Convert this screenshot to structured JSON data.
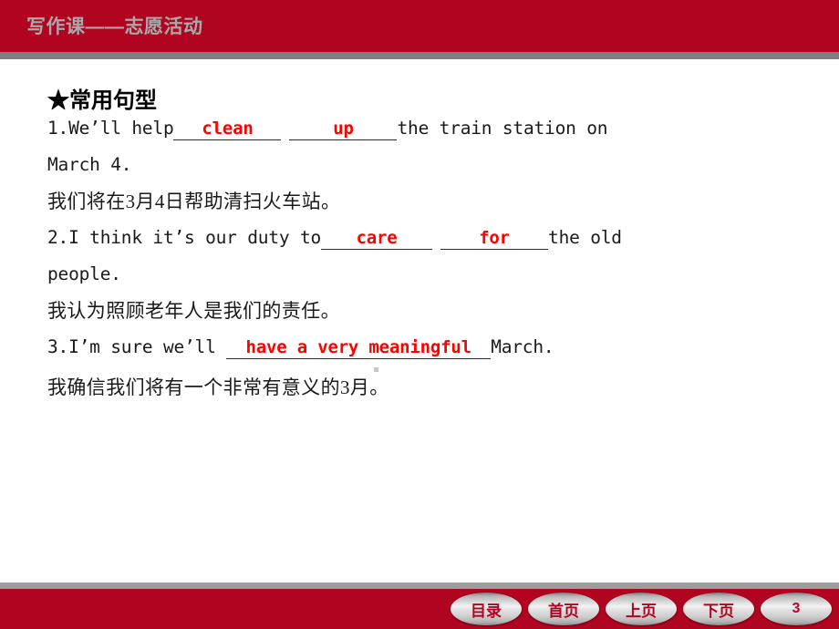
{
  "header": {
    "title": "写作课——志愿活动",
    "bar_color": "#b00420",
    "title_color": "#a8a8a8",
    "rule_color": "#7f7f7f"
  },
  "content": {
    "section_heading": "★常用句型",
    "sentences": [
      {
        "index": "1.",
        "en_pre": "1.We’ll help",
        "blank1": "clean",
        "blank2": "up",
        "en_mid": "",
        "en_post": "the train station on",
        "en_wrap": "March 4.",
        "zh": "我们将在3月4日帮助清扫火车站。"
      },
      {
        "index": "2.",
        "en_pre": "2.I think it’s our duty to",
        "blank1": "care",
        "blank2": "for",
        "en_post": "the old",
        "en_wrap": "people.",
        "zh": "我认为照顾老年人是我们的责任。"
      },
      {
        "index": "3.",
        "en_pre": "3.I’m sure we’ll ",
        "blank1": "have a very meaningful",
        "en_post": "March.",
        "zh": "我确信我们将有一个非常有意义的3月。"
      }
    ],
    "answer_color": "#ff0000"
  },
  "footer": {
    "bar_color": "#b00420",
    "rule_color": "#9e9e9e",
    "buttons": [
      {
        "label": "目录",
        "name": "contents"
      },
      {
        "label": "首页",
        "name": "home"
      },
      {
        "label": "上页",
        "name": "previous"
      },
      {
        "label": "下页",
        "name": "next"
      }
    ],
    "page_number": "3"
  }
}
